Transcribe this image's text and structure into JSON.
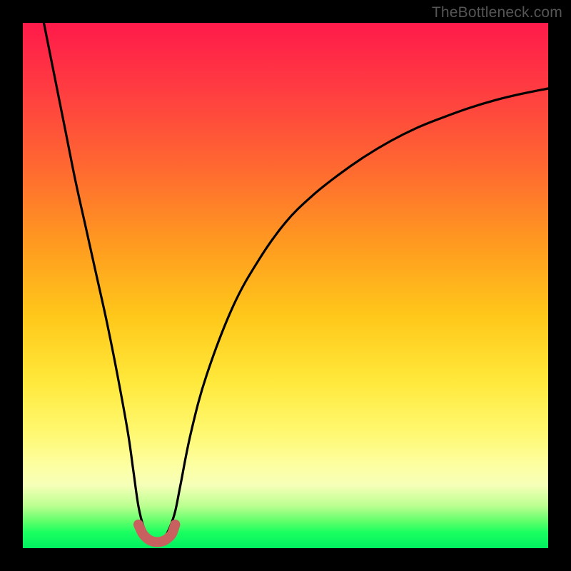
{
  "watermark": "TheBottleneck.com",
  "colors": {
    "curve_stroke": "#000000",
    "marker_stroke": "#c86060",
    "marker_fill": "#c86060",
    "frame": "#000000"
  },
  "chart_data": {
    "type": "line",
    "title": "",
    "xlabel": "",
    "ylabel": "",
    "xlim": [
      0,
      100
    ],
    "ylim": [
      0,
      100
    ],
    "grid": false,
    "legend": false,
    "series": [
      {
        "name": "left-branch",
        "x": [
          4,
          6,
          8,
          10,
          12,
          14,
          16,
          18,
          20,
          21,
          22,
          23,
          24
        ],
        "y": [
          100,
          90,
          80,
          70,
          61,
          52,
          43,
          33,
          22,
          15,
          8,
          4,
          2
        ]
      },
      {
        "name": "right-branch",
        "x": [
          27,
          28,
          29,
          30,
          32,
          35,
          40,
          45,
          50,
          55,
          60,
          65,
          70,
          75,
          80,
          85,
          90,
          95,
          100
        ],
        "y": [
          2,
          4,
          7,
          12,
          22,
          33,
          46,
          55,
          62,
          67,
          71,
          74.5,
          77.5,
          80,
          82,
          83.8,
          85.3,
          86.5,
          87.5
        ]
      },
      {
        "name": "bottom-u",
        "x": [
          22,
          22.8,
          23.6,
          24.4,
          25.2,
          26,
          26.8,
          27.6,
          28.4,
          29
        ],
        "y": [
          4.5,
          2.8,
          1.9,
          1.4,
          1.2,
          1.2,
          1.4,
          1.9,
          2.8,
          4.5
        ]
      }
    ],
    "annotations": []
  }
}
